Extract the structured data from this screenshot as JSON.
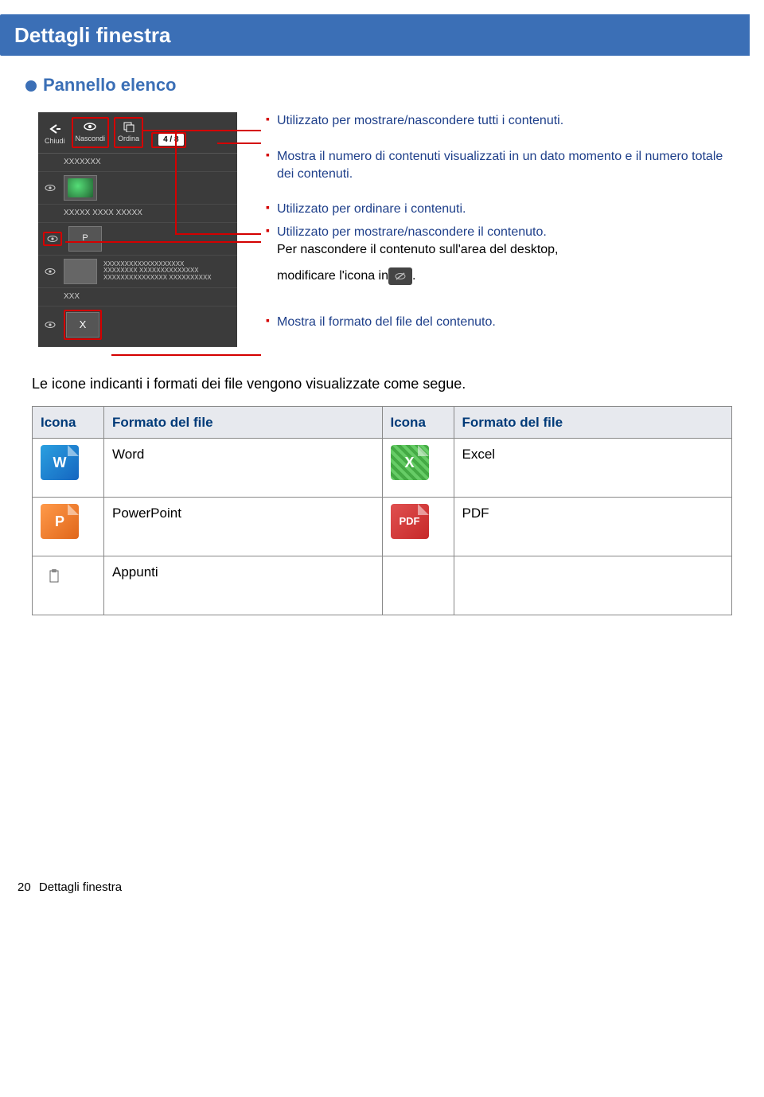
{
  "title": "Dettagli finestra",
  "subtitle": "Pannello elenco",
  "panel": {
    "buttons": {
      "close": "Chiudi",
      "hide": "Nascondi",
      "sort": "Ordina"
    },
    "counter": "4 / 8",
    "rows": {
      "r1": "XXXXXXX",
      "r2": "XXXXX XXXX XXXXX",
      "r4a": "XXXXXXXXXXXXXXXXXXX",
      "r4b": "XXXXXXXX XXXXXXXXXXXXXX",
      "r4c": "XXXXXXXXXXXXXXX XXXXXXXXXX",
      "r5": "XXX"
    }
  },
  "callouts": {
    "c1": "Utilizzato per mostrare/nascondere tutti i contenuti.",
    "c2": "Mostra il numero di contenuti visualizzati in un dato momento e il numero totale dei contenuti.",
    "c3": "Utilizzato per ordinare i contenuti.",
    "c4a": "Utilizzato per mostrare/nascondere il contenuto.",
    "c4b": "Per nascondere il contenuto sull'area del desktop,",
    "c4c_pre": "modificare l'icona in ",
    "c4c_post": ".",
    "c5": "Mostra il formato del file del contenuto."
  },
  "body": "Le icone indicanti i formati dei file vengono visualizzate come segue.",
  "table": {
    "h1": "Icona",
    "h2": "Formato del file",
    "h3": "Icona",
    "h4": "Formato del file",
    "word": "Word",
    "excel": "Excel",
    "powerpoint": "PowerPoint",
    "pdf": "PDF",
    "appunti": "Appunti"
  },
  "footer": {
    "page": "20",
    "label": "Dettagli finestra"
  }
}
